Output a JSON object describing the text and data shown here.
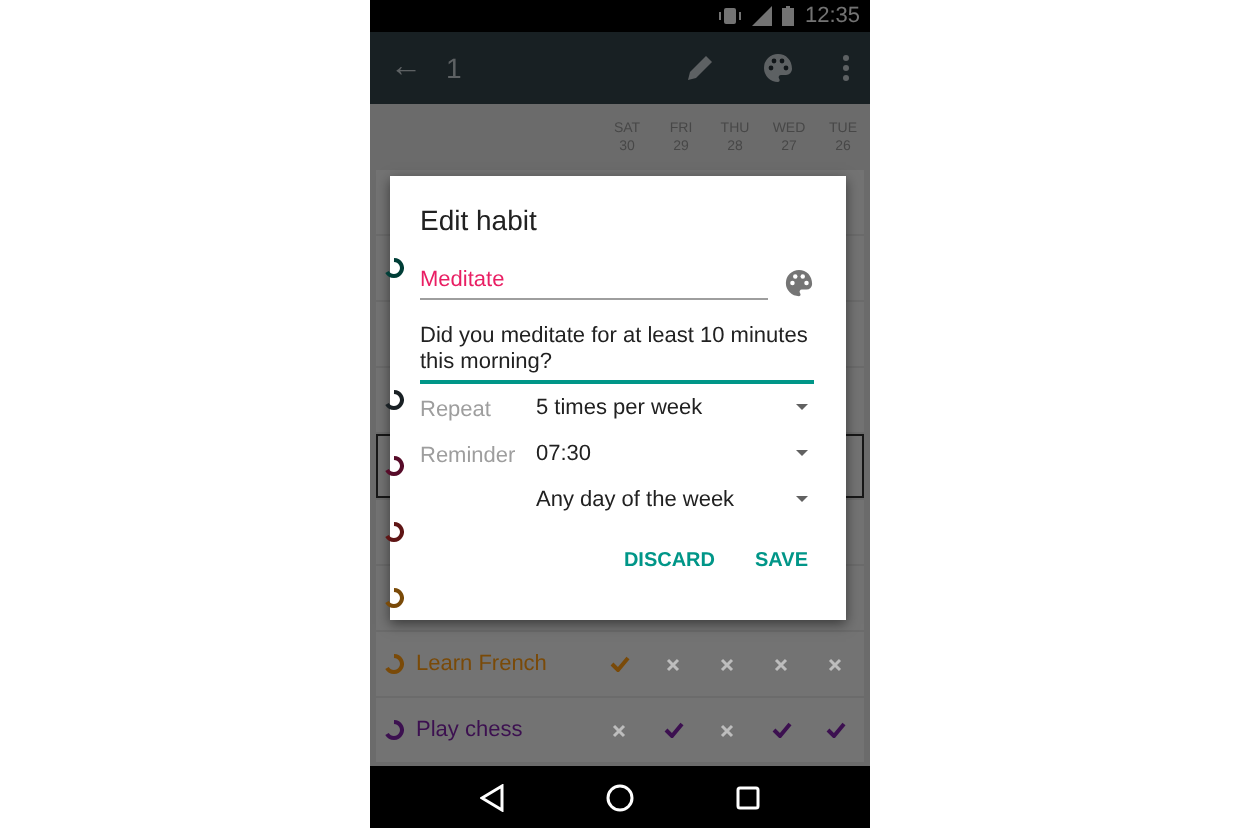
{
  "status_bar": {
    "time": "12:35"
  },
  "toolbar": {
    "back": "←",
    "title": "1"
  },
  "days": [
    {
      "day": "SAT",
      "date": "30"
    },
    {
      "day": "FRI",
      "date": "29"
    },
    {
      "day": "THU",
      "date": "28"
    },
    {
      "day": "WED",
      "date": "27"
    },
    {
      "day": "TUE",
      "date": "26"
    }
  ],
  "habits": [
    {
      "selected": false
    },
    {
      "color": "#003e37",
      "selected": false
    },
    {
      "selected": false
    },
    {
      "color": "#192024",
      "selected": false
    },
    {
      "color": "#570b29",
      "selected": true
    },
    {
      "color": "#5f1515",
      "selected": false
    },
    {
      "color": "#7a4a08",
      "selected": false
    },
    {
      "name": "Learn French",
      "color": "#7a4a08",
      "selected": false,
      "checks": [
        true,
        false,
        false,
        false,
        false
      ]
    },
    {
      "name": "Play chess",
      "color": "#3c1050",
      "selected": false,
      "checks": [
        false,
        true,
        false,
        true,
        true
      ]
    }
  ],
  "dialog": {
    "title": "Edit habit",
    "name_field": {
      "value": "Meditate"
    },
    "question_field": {
      "value": "Did you meditate for at least 10 minutes this morning?"
    },
    "rows": [
      {
        "label": "Repeat",
        "value": "5 times per week"
      },
      {
        "label": "Reminder",
        "value": "07:30"
      },
      {
        "value": "Any day of the week"
      }
    ],
    "buttons": [
      "DISCARD",
      "SAVE"
    ]
  }
}
